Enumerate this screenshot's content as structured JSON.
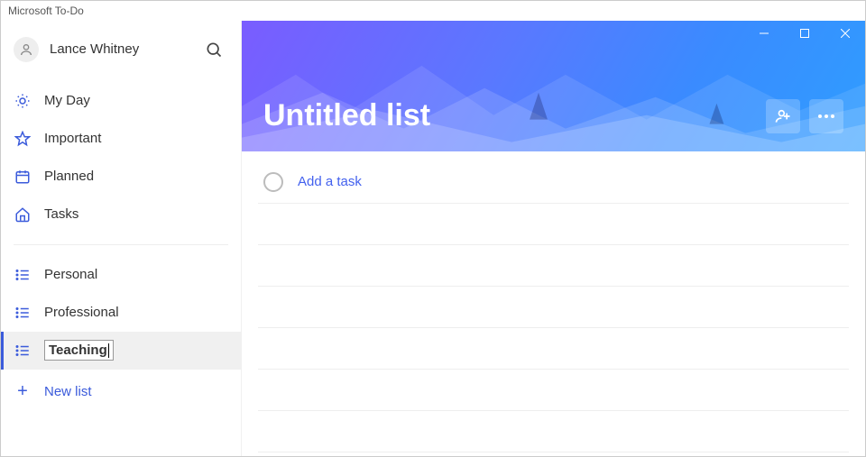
{
  "app_title": "Microsoft To-Do",
  "user": {
    "name": "Lance Whitney"
  },
  "smart_lists": [
    {
      "icon": "sun",
      "label": "My Day"
    },
    {
      "icon": "star",
      "label": "Important"
    },
    {
      "icon": "cal",
      "label": "Planned"
    },
    {
      "icon": "home",
      "label": "Tasks"
    }
  ],
  "user_lists": [
    {
      "label": "Personal",
      "editing": false,
      "active": false
    },
    {
      "label": "Professional",
      "editing": false,
      "active": false
    },
    {
      "label": "Teaching",
      "editing": true,
      "active": true
    }
  ],
  "new_list_label": "New list",
  "current_list_title": "Untitled list",
  "add_task_placeholder": "Add a task"
}
